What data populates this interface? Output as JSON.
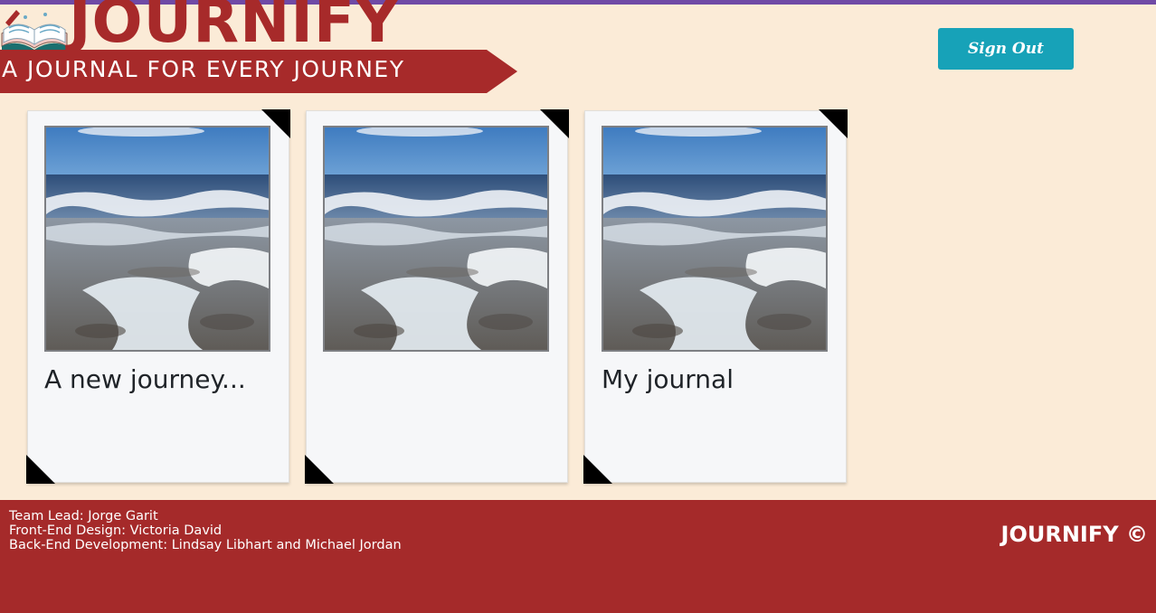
{
  "header": {
    "brand": "JOURNIFY",
    "tagline": "A JOURNAL FOR EVERY JOURNEY",
    "signout_label": "Sign Out"
  },
  "journals": [
    {
      "title": "A new journey...",
      "image": "ocean-waves-photo"
    },
    {
      "title": "",
      "image": "ocean-waves-photo"
    },
    {
      "title": "My journal",
      "image": "ocean-waves-photo"
    }
  ],
  "footer": {
    "credits": [
      "Team Lead: Jorge Garit",
      "Front-End Design: Victoria David",
      "Back-End Development: Lindsay Libhart and Michael Jordan"
    ],
    "brand": "JOURNIFY ©"
  },
  "colors": {
    "background": "#fbebd7",
    "brand_red": "#a72a2a",
    "accent_teal": "#17a2b8",
    "top_rule": "#6f4aa6"
  }
}
